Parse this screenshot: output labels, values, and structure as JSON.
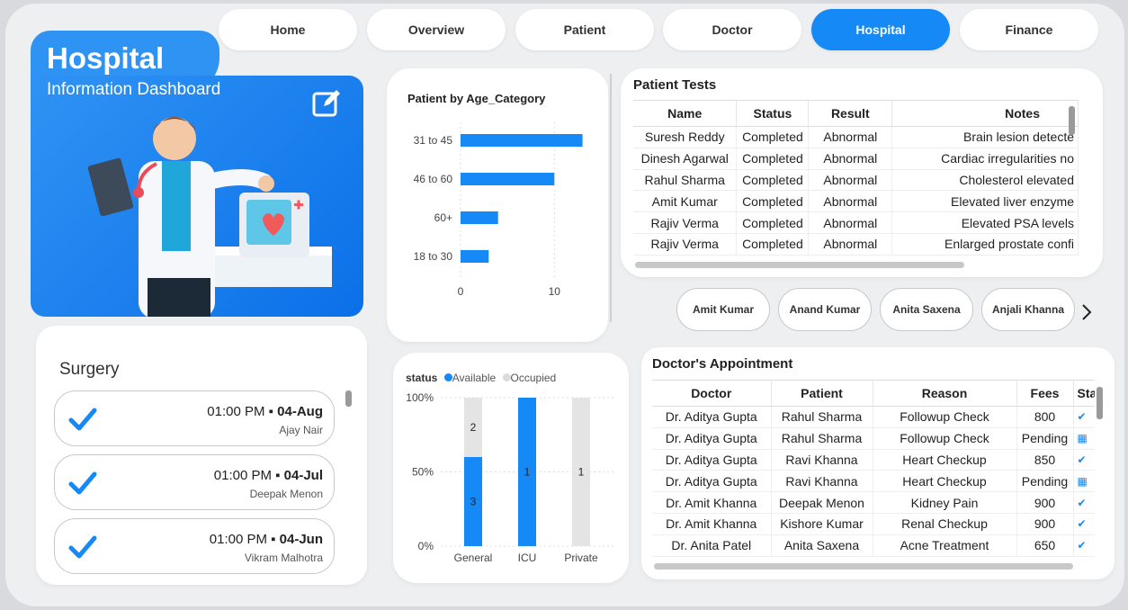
{
  "nav": [
    "Home",
    "Overview",
    "Patient",
    "Doctor",
    "Hospital",
    "Finance"
  ],
  "nav_active": 4,
  "hero": {
    "title": "Hospital",
    "subtitle": "Information Dashboard"
  },
  "surgery": {
    "title": "Surgery",
    "items": [
      {
        "time": "01:00 PM",
        "date": "04-Aug",
        "name": "Ajay Nair"
      },
      {
        "time": "01:00 PM",
        "date": "04-Jul",
        "name": "Deepak Menon"
      },
      {
        "time": "01:00 PM",
        "date": "04-Jun",
        "name": "Vikram Malhotra"
      }
    ]
  },
  "age_chart": {
    "title": "Patient by Age_Category",
    "chart_data": {
      "type": "bar",
      "orientation": "horizontal",
      "categories": [
        "31 to 45",
        "46 to 60",
        "60+",
        "18 to 30"
      ],
      "values": [
        13,
        10,
        4,
        3
      ],
      "xticks": [
        "0",
        "10"
      ],
      "xlim": [
        0,
        14
      ],
      "color": "#1589f5"
    }
  },
  "status_chart": {
    "legend_title": "status",
    "chart_data": {
      "type": "bar",
      "stacked": "100%",
      "categories": [
        "General",
        "ICU",
        "Private"
      ],
      "series": [
        {
          "name": "Available",
          "color": "#1589f5",
          "values": [
            3,
            1,
            0
          ]
        },
        {
          "name": "Occupied",
          "color": "#e4e4e4",
          "values": [
            2,
            0,
            1
          ]
        }
      ],
      "yticks": [
        "100%",
        "50%",
        "0%"
      ]
    }
  },
  "patient_tests": {
    "title": "Patient Tests",
    "columns": [
      "Name",
      "Status",
      "Result",
      "Notes"
    ],
    "rows": [
      [
        "Suresh Reddy",
        "Completed",
        "Abnormal",
        "Brain lesion detecte"
      ],
      [
        "Dinesh Agarwal",
        "Completed",
        "Abnormal",
        "Cardiac irregularities no"
      ],
      [
        "Rahul Sharma",
        "Completed",
        "Abnormal",
        "Cholesterol elevated"
      ],
      [
        "Amit Kumar",
        "Completed",
        "Abnormal",
        "Elevated liver enzyme"
      ],
      [
        "Rajiv Verma",
        "Completed",
        "Abnormal",
        "Elevated PSA levels"
      ],
      [
        "Rajiv Verma",
        "Completed",
        "Abnormal",
        "Enlarged prostate confi"
      ]
    ]
  },
  "doctor_chips": [
    "Amit Kumar",
    "Anand Kumar",
    "Anita Saxena",
    "Anjali Khanna"
  ],
  "appointments": {
    "title": "Doctor's Appointment",
    "columns": [
      "Doctor",
      "Patient",
      "Reason",
      "Fees",
      "Sta"
    ],
    "rows": [
      [
        "Dr. Aditya Gupta",
        "Rahul Sharma",
        "Followup Check",
        "800",
        "check"
      ],
      [
        "Dr. Aditya Gupta",
        "Rahul Sharma",
        "Followup Check",
        "Pending",
        "calendar"
      ],
      [
        "Dr. Aditya Gupta",
        "Ravi Khanna",
        "Heart Checkup",
        "850",
        "check"
      ],
      [
        "Dr. Aditya Gupta",
        "Ravi Khanna",
        "Heart Checkup",
        "Pending",
        "calendar"
      ],
      [
        "Dr. Amit Khanna",
        "Deepak Menon",
        "Kidney Pain",
        "900",
        "check"
      ],
      [
        "Dr. Amit Khanna",
        "Kishore Kumar",
        "Renal Checkup",
        "900",
        "check"
      ],
      [
        "Dr. Anita Patel",
        "Anita Saxena",
        "Acne Treatment",
        "650",
        "check"
      ]
    ]
  }
}
